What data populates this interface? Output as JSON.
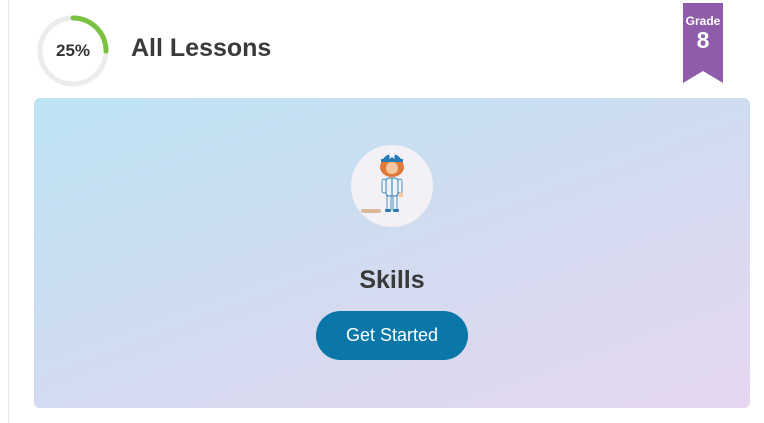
{
  "progress": {
    "percent": 25,
    "label": "25%"
  },
  "header": {
    "title": "All Lessons"
  },
  "grade": {
    "label": "Grade",
    "number": "8"
  },
  "lesson": {
    "title": "Skills",
    "button_label": "Get Started",
    "avatar_icon": "baseball-player-icon"
  },
  "colors": {
    "progress_arc": "#7cc242",
    "grade_ribbon": "#8e5ca8",
    "button": "#0a77a8"
  }
}
